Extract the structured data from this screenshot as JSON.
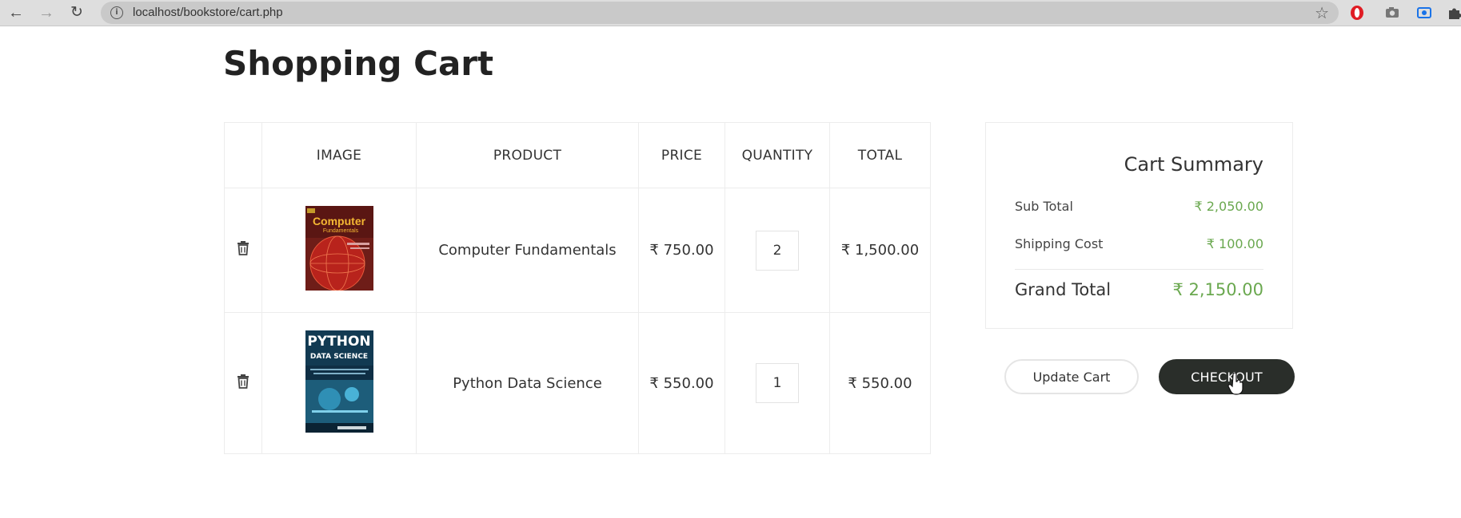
{
  "browser": {
    "url": "localhost/bookstore/cart.php",
    "back_icon": "←",
    "forward_icon": "→",
    "reload_icon": "↻",
    "bookmark_icon": "☆"
  },
  "page": {
    "title": "Shopping Cart"
  },
  "table": {
    "headers": [
      "",
      "IMAGE",
      "PRODUCT",
      "PRICE",
      "QUANTITY",
      "TOTAL"
    ],
    "rows": [
      {
        "product": "Computer Fundamentals",
        "price": "₹ 750.00",
        "quantity": "2",
        "total": "₹ 1,500.00",
        "cover_title": "Computer",
        "cover_subtitle": "Fundamentals"
      },
      {
        "product": "Python Data Science",
        "price": "₹ 550.00",
        "quantity": "1",
        "total": "₹ 550.00",
        "cover_title": "PYTHON",
        "cover_subtitle": "DATA SCIENCE"
      }
    ]
  },
  "summary": {
    "title": "Cart Summary",
    "sub_total_label": "Sub Total",
    "sub_total": "₹ 2,050.00",
    "shipping_label": "Shipping Cost",
    "shipping": "₹ 100.00",
    "grand_total_label": "Grand Total",
    "grand_total": "₹ 2,150.00",
    "accent_color": "#6aa84f"
  },
  "actions": {
    "update_label": "Update Cart",
    "checkout_label": "CHECKOUT"
  }
}
